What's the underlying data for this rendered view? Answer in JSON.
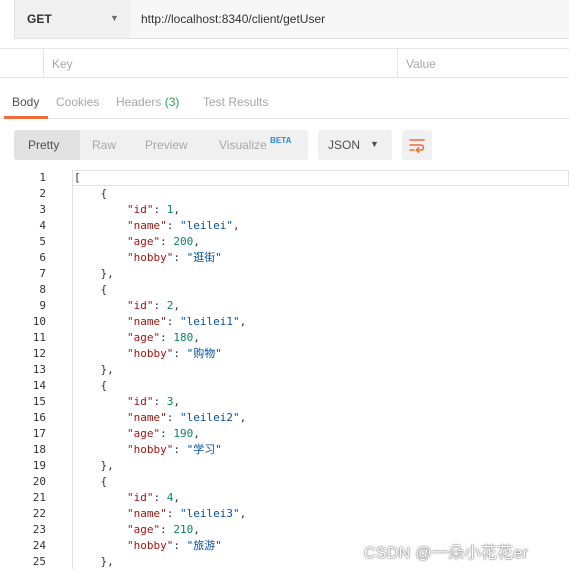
{
  "request": {
    "method": "GET",
    "url": "http://localhost:8340/client/getUser"
  },
  "params": {
    "key_header": "Key",
    "value_header": "Value"
  },
  "response_tabs": [
    {
      "label": "Body",
      "active": true
    },
    {
      "label": "Cookies"
    },
    {
      "label": "Headers",
      "count": "(3)"
    },
    {
      "label": "Test Results"
    }
  ],
  "format_toolbar": {
    "options": [
      "Pretty",
      "Raw",
      "Preview",
      "Visualize"
    ],
    "beta_label": "BETA",
    "active": "Pretty",
    "language": "JSON",
    "wrap_icon": "wrap-lines-icon"
  },
  "colors": {
    "accent": "#f26b3a",
    "count_green": "#26a55c",
    "json_key": "#a31515",
    "json_string": "#0451a5",
    "json_number": "#098658"
  },
  "code_lines": [
    {
      "n": "1",
      "t": [
        [
          "p",
          "["
        ]
      ]
    },
    {
      "n": "2",
      "t": [
        [
          "p",
          "    {"
        ]
      ]
    },
    {
      "n": "3",
      "t": [
        [
          "p",
          "        "
        ],
        [
          "k",
          "\"id\""
        ],
        [
          "p",
          ": "
        ],
        [
          "n",
          "1"
        ],
        [
          "p",
          ","
        ]
      ]
    },
    {
      "n": "4",
      "t": [
        [
          "p",
          "        "
        ],
        [
          "k",
          "\"name\""
        ],
        [
          "p",
          ": "
        ],
        [
          "s",
          "\"leilei\""
        ],
        [
          "p",
          ","
        ]
      ]
    },
    {
      "n": "5",
      "t": [
        [
          "p",
          "        "
        ],
        [
          "k",
          "\"age\""
        ],
        [
          "p",
          ": "
        ],
        [
          "n",
          "200"
        ],
        [
          "p",
          ","
        ]
      ]
    },
    {
      "n": "6",
      "t": [
        [
          "p",
          "        "
        ],
        [
          "k",
          "\"hobby\""
        ],
        [
          "p",
          ": "
        ],
        [
          "s",
          "\"逛街\""
        ]
      ]
    },
    {
      "n": "7",
      "t": [
        [
          "p",
          "    },"
        ]
      ]
    },
    {
      "n": "8",
      "t": [
        [
          "p",
          "    {"
        ]
      ]
    },
    {
      "n": "9",
      "t": [
        [
          "p",
          "        "
        ],
        [
          "k",
          "\"id\""
        ],
        [
          "p",
          ": "
        ],
        [
          "n",
          "2"
        ],
        [
          "p",
          ","
        ]
      ]
    },
    {
      "n": "10",
      "t": [
        [
          "p",
          "        "
        ],
        [
          "k",
          "\"name\""
        ],
        [
          "p",
          ": "
        ],
        [
          "s",
          "\"leilei1\""
        ],
        [
          "p",
          ","
        ]
      ]
    },
    {
      "n": "11",
      "t": [
        [
          "p",
          "        "
        ],
        [
          "k",
          "\"age\""
        ],
        [
          "p",
          ": "
        ],
        [
          "n",
          "180"
        ],
        [
          "p",
          ","
        ]
      ]
    },
    {
      "n": "12",
      "t": [
        [
          "p",
          "        "
        ],
        [
          "k",
          "\"hobby\""
        ],
        [
          "p",
          ": "
        ],
        [
          "s",
          "\"购物\""
        ]
      ]
    },
    {
      "n": "13",
      "t": [
        [
          "p",
          "    },"
        ]
      ]
    },
    {
      "n": "14",
      "t": [
        [
          "p",
          "    {"
        ]
      ]
    },
    {
      "n": "15",
      "t": [
        [
          "p",
          "        "
        ],
        [
          "k",
          "\"id\""
        ],
        [
          "p",
          ": "
        ],
        [
          "n",
          "3"
        ],
        [
          "p",
          ","
        ]
      ]
    },
    {
      "n": "16",
      "t": [
        [
          "p",
          "        "
        ],
        [
          "k",
          "\"name\""
        ],
        [
          "p",
          ": "
        ],
        [
          "s",
          "\"leilei2\""
        ],
        [
          "p",
          ","
        ]
      ]
    },
    {
      "n": "17",
      "t": [
        [
          "p",
          "        "
        ],
        [
          "k",
          "\"age\""
        ],
        [
          "p",
          ": "
        ],
        [
          "n",
          "190"
        ],
        [
          "p",
          ","
        ]
      ]
    },
    {
      "n": "18",
      "t": [
        [
          "p",
          "        "
        ],
        [
          "k",
          "\"hobby\""
        ],
        [
          "p",
          ": "
        ],
        [
          "s",
          "\"学习\""
        ]
      ]
    },
    {
      "n": "19",
      "t": [
        [
          "p",
          "    },"
        ]
      ]
    },
    {
      "n": "20",
      "t": [
        [
          "p",
          "    {"
        ]
      ]
    },
    {
      "n": "21",
      "t": [
        [
          "p",
          "        "
        ],
        [
          "k",
          "\"id\""
        ],
        [
          "p",
          ": "
        ],
        [
          "n",
          "4"
        ],
        [
          "p",
          ","
        ]
      ]
    },
    {
      "n": "22",
      "t": [
        [
          "p",
          "        "
        ],
        [
          "k",
          "\"name\""
        ],
        [
          "p",
          ": "
        ],
        [
          "s",
          "\"leilei3\""
        ],
        [
          "p",
          ","
        ]
      ]
    },
    {
      "n": "23",
      "t": [
        [
          "p",
          "        "
        ],
        [
          "k",
          "\"age\""
        ],
        [
          "p",
          ": "
        ],
        [
          "n",
          "210"
        ],
        [
          "p",
          ","
        ]
      ]
    },
    {
      "n": "24",
      "t": [
        [
          "p",
          "        "
        ],
        [
          "k",
          "\"hobby\""
        ],
        [
          "p",
          ": "
        ],
        [
          "s",
          "\"旅游\""
        ]
      ]
    },
    {
      "n": "25",
      "t": [
        [
          "p",
          "    },"
        ]
      ]
    }
  ],
  "watermark": "CSDN @一朵小花花er"
}
